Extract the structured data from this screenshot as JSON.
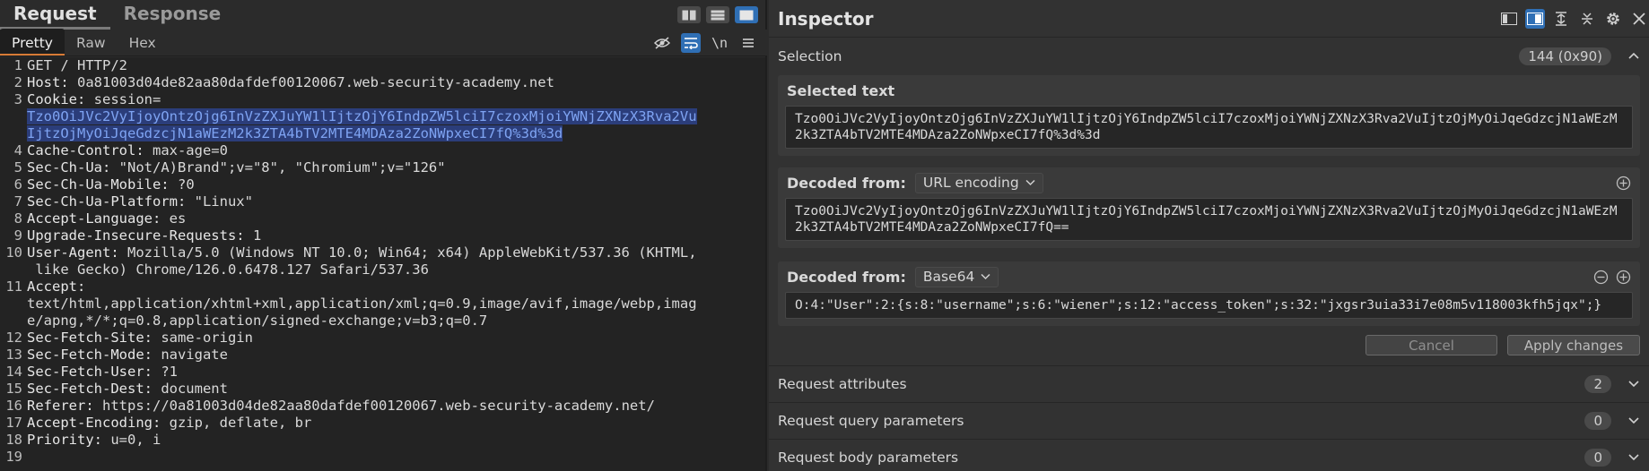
{
  "request_panel": {
    "tabs": [
      "Request",
      "Response"
    ],
    "view_tabs": [
      "Pretty",
      "Raw",
      "Hex"
    ],
    "newline_toggle": "\\n",
    "lines": [
      {
        "n": "1",
        "text": "GET / HTTP/2"
      },
      {
        "n": "2",
        "name": "Host: ",
        "value": "0a81003d04de82aa80dafdef00120067.web-security-academy.net"
      },
      {
        "n": "3",
        "name": "Cookie: ",
        "value": "session="
      },
      {
        "n": "",
        "hl": "Tzo0OiJVc2VyIjoyOntzOjg6InVzZXJuYW1lIjtzOjY6IndpZW5lciI7czoxMjoiYWNjZXNzX3Rva2Vu"
      },
      {
        "n": "",
        "hl": "IjtzOjMyOiJqeGdzcjN1aWEzM2k3ZTA4bTV2MTE4MDAza2ZoNWpxeCI7fQ%3d%3d"
      },
      {
        "n": "4",
        "name": "Cache-Control: ",
        "value": "max-age=0"
      },
      {
        "n": "5",
        "name": "Sec-Ch-Ua: ",
        "value": "\"Not/A)Brand\";v=\"8\", \"Chromium\";v=\"126\""
      },
      {
        "n": "6",
        "name": "Sec-Ch-Ua-Mobile: ",
        "value": "?0"
      },
      {
        "n": "7",
        "name": "Sec-Ch-Ua-Platform: ",
        "value": "\"Linux\""
      },
      {
        "n": "8",
        "name": "Accept-Language: ",
        "value": "es"
      },
      {
        "n": "9",
        "name": "Upgrade-Insecure-Requests: ",
        "value": "1"
      },
      {
        "n": "10",
        "name": "User-Agent: ",
        "value": "Mozilla/5.0 (Windows NT 10.0; Win64; x64) AppleWebKit/537.36 (KHTML,"
      },
      {
        "n": "",
        "value": " like Gecko) Chrome/126.0.6478.127 Safari/537.36"
      },
      {
        "n": "11",
        "name": "Accept:",
        "value": ""
      },
      {
        "n": "",
        "value": "text/html,application/xhtml+xml,application/xml;q=0.9,image/avif,image/webp,imag"
      },
      {
        "n": "",
        "value": "e/apng,*/*;q=0.8,application/signed-exchange;v=b3;q=0.7"
      },
      {
        "n": "12",
        "name": "Sec-Fetch-Site: ",
        "value": "same-origin"
      },
      {
        "n": "13",
        "name": "Sec-Fetch-Mode: ",
        "value": "navigate"
      },
      {
        "n": "14",
        "name": "Sec-Fetch-User: ",
        "value": "?1"
      },
      {
        "n": "15",
        "name": "Sec-Fetch-Dest: ",
        "value": "document"
      },
      {
        "n": "16",
        "name": "Referer: ",
        "value": "https://0a81003d04de82aa80dafdef00120067.web-security-academy.net/"
      },
      {
        "n": "17",
        "name": "Accept-Encoding: ",
        "value": "gzip, deflate, br"
      },
      {
        "n": "18",
        "name": "Priority: ",
        "value": "u=0, i"
      },
      {
        "n": "19",
        "value": ""
      }
    ]
  },
  "inspector": {
    "title": "Inspector",
    "selection": {
      "label": "Selection",
      "count": "144 (0x90)"
    },
    "selected_text": {
      "label": "Selected text",
      "value": "Tzo0OiJVc2VyIjoyOntzOjg6InVzZXJuYW1lIjtzOjY6IndpZW5lciI7czoxMjoiYWNjZXNzX3Rva2VuIjtzOjMyOiJqeGdzcjN1aWEzM2k3ZTA4bTV2MTE4MDAza2ZoNWpxeCI7fQ%3d%3d"
    },
    "decoded_url": {
      "label": "Decoded from:",
      "encoding": "URL encoding",
      "value": "Tzo0OiJVc2VyIjoyOntzOjg6InVzZXJuYW1lIjtzOjY6IndpZW5lciI7czoxMjoiYWNjZXNzX3Rva2VuIjtzOjMyOiJqeGdzcjN1aWEzM2k3ZTA4bTV2MTE4MDAza2ZoNWpxeCI7fQ=="
    },
    "decoded_b64": {
      "label": "Decoded from:",
      "encoding": "Base64",
      "value": "O:4:\"User\":2:{s:8:\"username\";s:6:\"wiener\";s:12:\"access_token\";s:32:\"jxgsr3uia33i7e08m5v118003kfh5jqx\";}"
    },
    "cancel_label": "Cancel",
    "apply_label": "Apply changes",
    "sections": [
      {
        "label": "Request attributes",
        "count": "2"
      },
      {
        "label": "Request query parameters",
        "count": "0"
      },
      {
        "label": "Request body parameters",
        "count": "0"
      }
    ]
  },
  "colors": {
    "accent_blue": "#2f6fb5",
    "tab_underline_orange": "#d87b36",
    "highlight_bg": "#2b3d7a",
    "highlight_text": "#7ea3f2"
  }
}
